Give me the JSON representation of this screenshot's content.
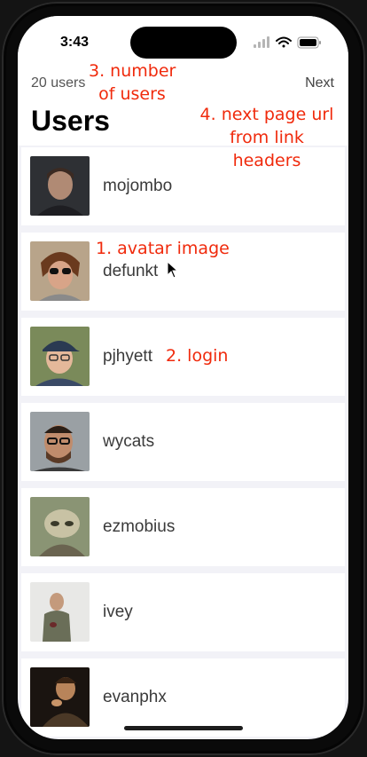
{
  "status_bar": {
    "time": "3:43"
  },
  "nav": {
    "user_count": "20 users",
    "next_label": "Next",
    "title": "Users"
  },
  "users": [
    {
      "login": "mojombo"
    },
    {
      "login": "defunkt"
    },
    {
      "login": "pjhyett"
    },
    {
      "login": "wycats"
    },
    {
      "login": "ezmobius"
    },
    {
      "login": "ivey"
    },
    {
      "login": "evanphx"
    }
  ],
  "annotations": {
    "number_of_users_line1": "3. number",
    "number_of_users_line2": "of users",
    "next_page_line1": "4. next page url",
    "next_page_line2": "from link",
    "next_page_line3": "headers",
    "avatar_image": "1. avatar image",
    "login": "2. login"
  },
  "colors": {
    "annotation": "#f02a0c",
    "background": "#f2f2f7",
    "row": "#ffffff"
  },
  "icons": [
    "signal-icon",
    "wifi-icon",
    "battery-icon",
    "cursor-icon"
  ]
}
